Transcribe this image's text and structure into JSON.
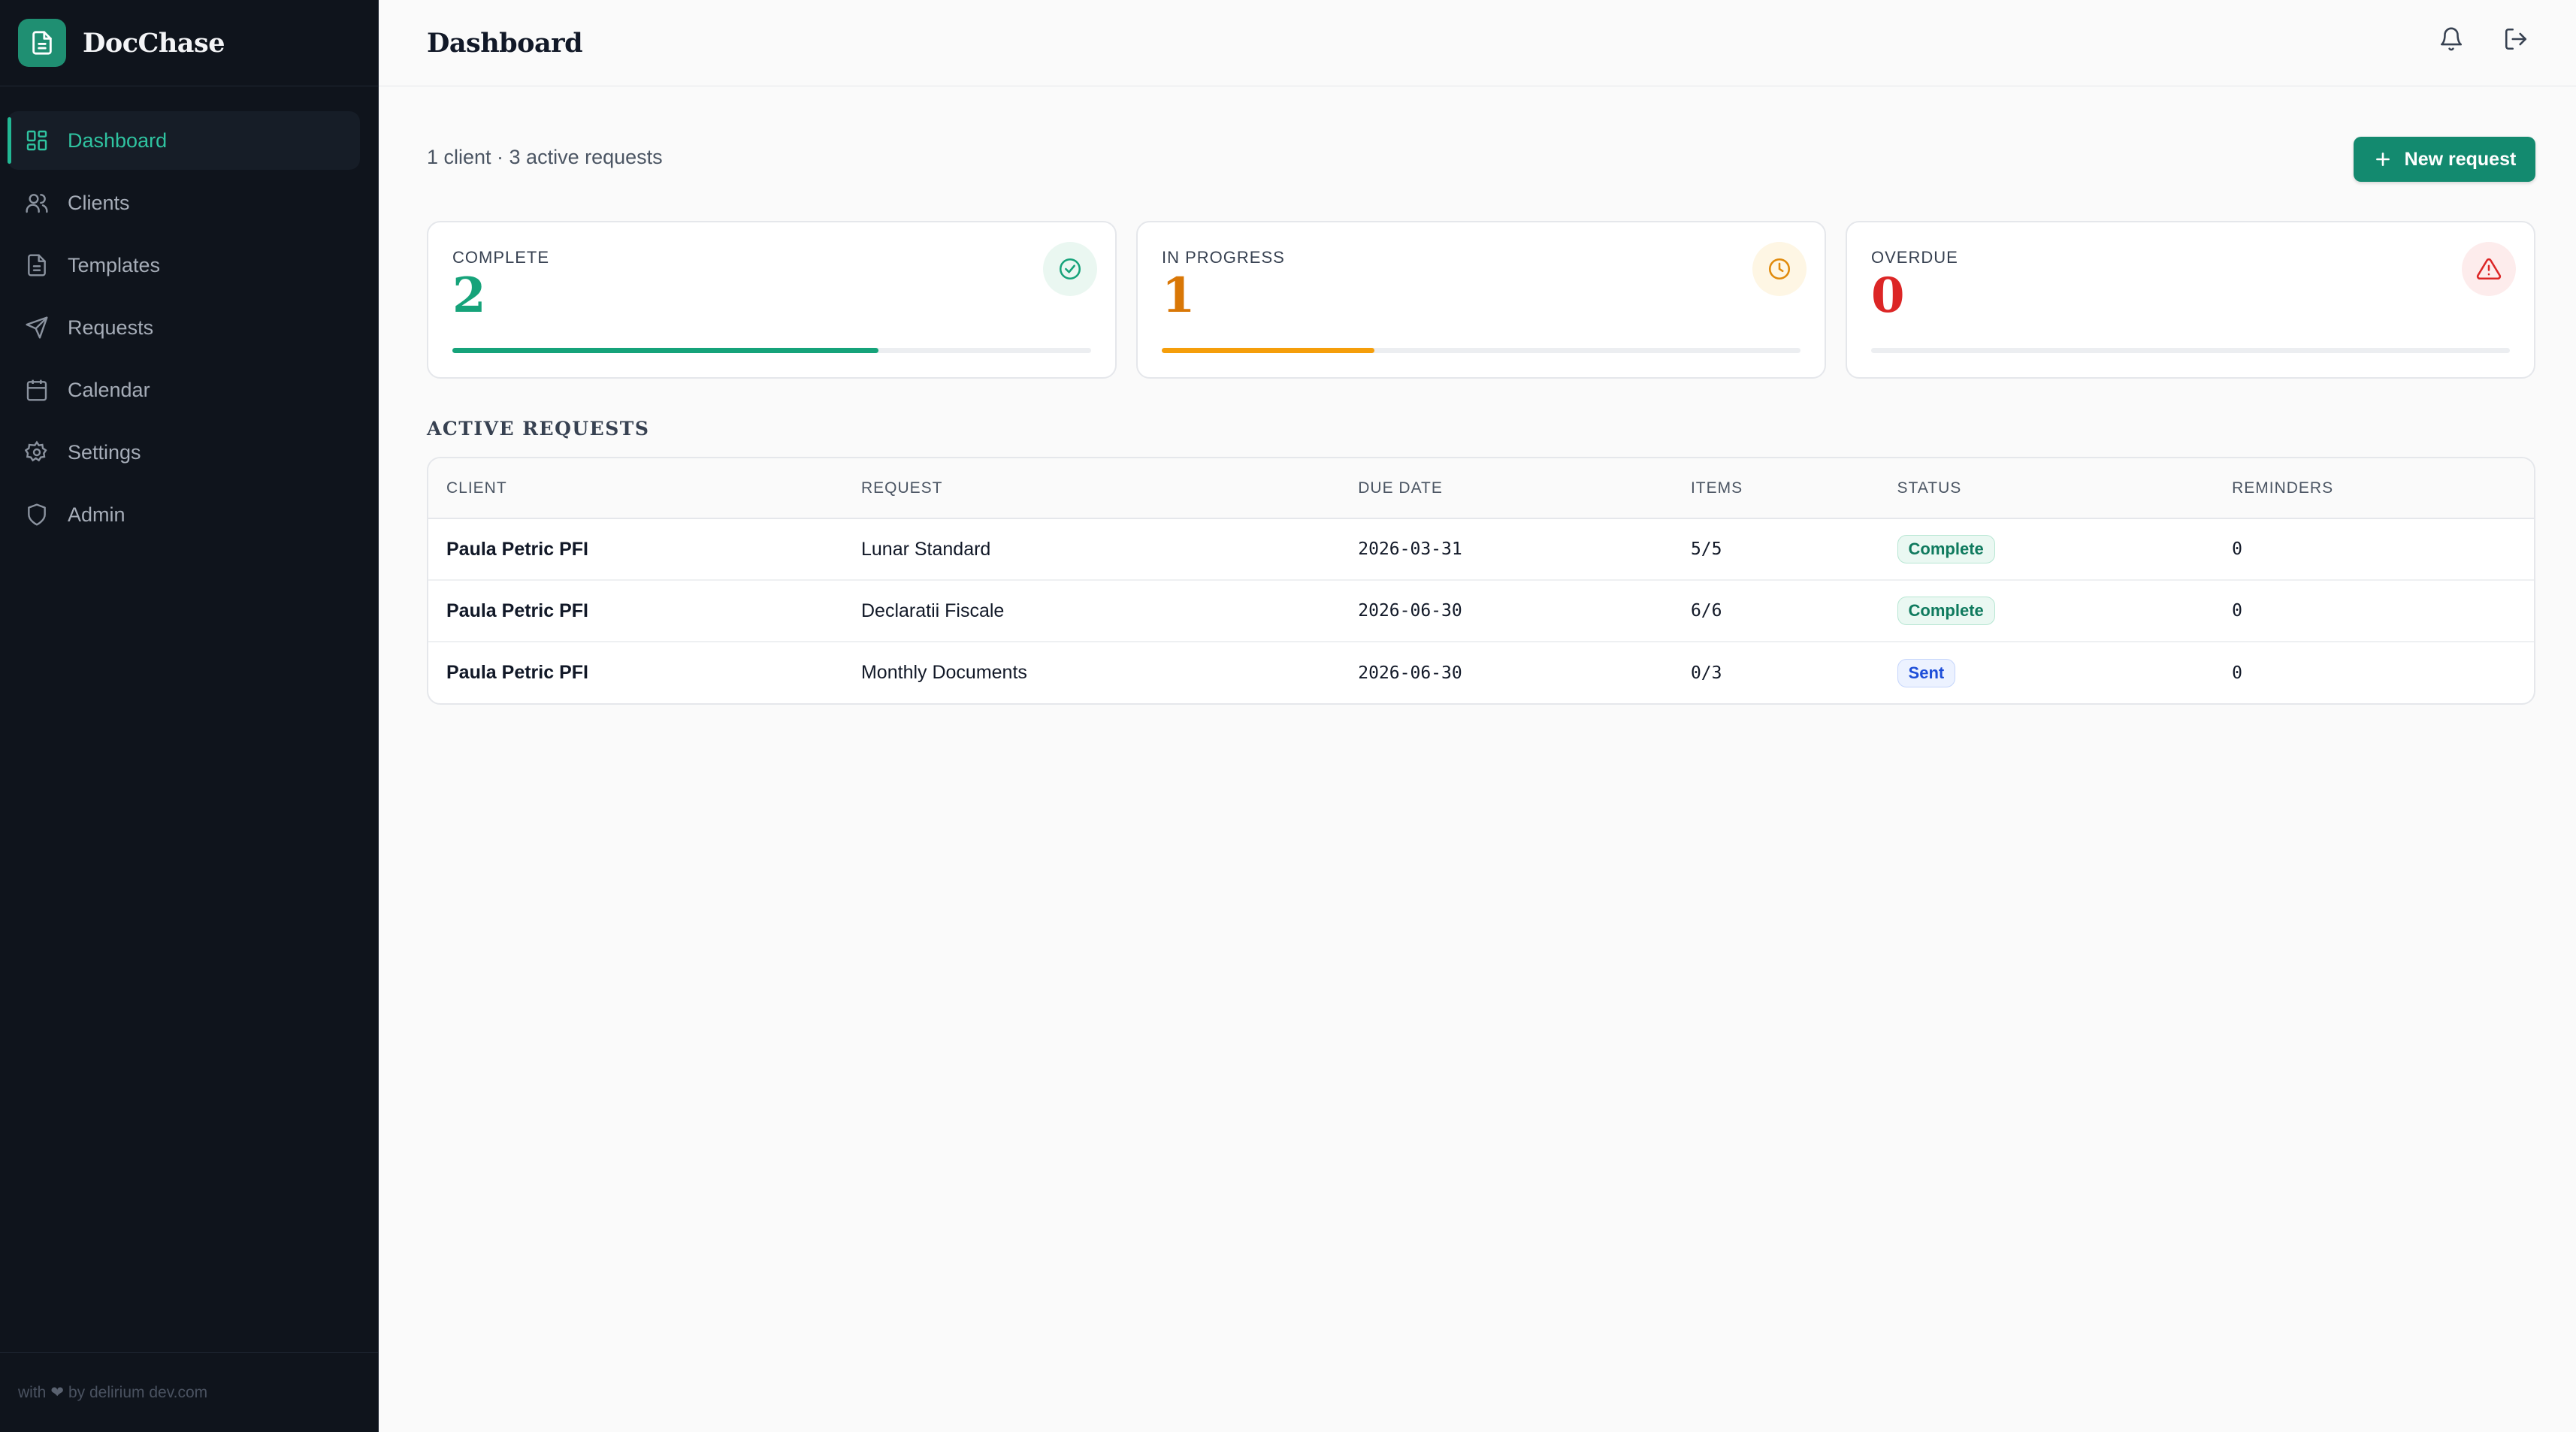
{
  "app": {
    "name": "DocChase"
  },
  "sidebar": {
    "items": [
      {
        "label": "Dashboard",
        "icon": "dashboard-icon",
        "active": true
      },
      {
        "label": "Clients",
        "icon": "users-icon"
      },
      {
        "label": "Templates",
        "icon": "file-icon"
      },
      {
        "label": "Requests",
        "icon": "send-icon"
      },
      {
        "label": "Calendar",
        "icon": "calendar-icon"
      },
      {
        "label": "Settings",
        "icon": "gear-icon"
      },
      {
        "label": "Admin",
        "icon": "shield-icon"
      }
    ],
    "footer": {
      "prefix": "with",
      "heart": "❤",
      "suffix": "by delirium dev.com"
    }
  },
  "header": {
    "title": "Dashboard",
    "icons": [
      "bell-icon",
      "logout-icon"
    ]
  },
  "summary": {
    "text": "1 client · 3 active requests",
    "new_request_label": "New request"
  },
  "cards": [
    {
      "label": "COMPLETE",
      "value": "2",
      "progress": 0.667,
      "color": "#16a37a",
      "icon": "check-circle-icon"
    },
    {
      "label": "IN PROGRESS",
      "value": "1",
      "progress": 0.333,
      "color": "#f59e0b",
      "value_color": "#d97706",
      "icon": "clock-icon"
    },
    {
      "label": "OVERDUE",
      "value": "0",
      "progress": 0,
      "color": "#dc2626",
      "icon": "alert-triangle-icon"
    }
  ],
  "active_requests": {
    "title": "ACTIVE REQUESTS",
    "columns": [
      "CLIENT",
      "REQUEST",
      "DUE DATE",
      "ITEMS",
      "STATUS",
      "REMINDERS"
    ],
    "rows": [
      {
        "client": "Paula Petric PFI",
        "request": "Lunar Standard",
        "due": "2026-03-31",
        "items": "5/5",
        "status": "Complete",
        "reminders": "0"
      },
      {
        "client": "Paula Petric PFI",
        "request": "Declaratii Fiscale",
        "due": "2026-06-30",
        "items": "6/6",
        "status": "Complete",
        "reminders": "0"
      },
      {
        "client": "Paula Petric PFI",
        "request": "Monthly Documents",
        "due": "2026-06-30",
        "items": "0/3",
        "status": "Sent",
        "reminders": "0"
      }
    ]
  }
}
